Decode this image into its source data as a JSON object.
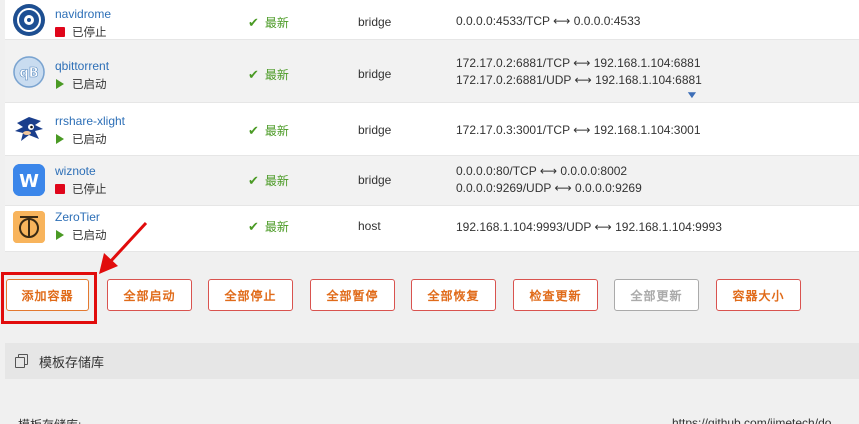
{
  "containers": [
    {
      "name": "navidrome",
      "status": "已停止",
      "state": "stopped",
      "update": "最新",
      "network": "bridge",
      "ports": [
        "0.0.0.0:4533/TCP ⟷ 0.0.0.0:4533"
      ]
    },
    {
      "name": "qbittorrent",
      "status": "已启动",
      "state": "running",
      "update": "最新",
      "network": "bridge",
      "ports": [
        "172.17.0.2:6881/TCP ⟷ 192.168.1.104:6881",
        "172.17.0.2:6881/UDP ⟷ 192.168.1.104:6881"
      ]
    },
    {
      "name": "rrshare-xlight",
      "status": "已启动",
      "state": "running",
      "update": "最新",
      "network": "bridge",
      "ports": [
        "172.17.0.3:3001/TCP ⟷ 192.168.1.104:3001"
      ]
    },
    {
      "name": "wiznote",
      "status": "已停止",
      "state": "stopped",
      "update": "最新",
      "network": "bridge",
      "ports": [
        "0.0.0.0:80/TCP ⟷ 0.0.0.0:8002",
        "0.0.0.0:9269/UDP ⟷ 0.0.0.0:9269"
      ]
    },
    {
      "name": "ZeroTier",
      "status": "已启动",
      "state": "running",
      "update": "最新",
      "network": "host",
      "ports": [
        "192.168.1.104:9993/UDP ⟷ 192.168.1.104:9993"
      ]
    }
  ],
  "icons": {
    "navidrome": "vinyl-record-icon",
    "qbittorrent": "qb-logo-icon",
    "rrshare": "sonic-hedgehog-icon",
    "wiznote": "w-logo-icon",
    "zerotier": "zerotier-logo-icon",
    "status_running": "play-triangle-icon",
    "status_stopped": "stop-square-icon",
    "update": "checkmark-icon",
    "expand": "chevron-down-icon",
    "section": "copy-icon"
  },
  "buttons": {
    "add_container": "添加容器",
    "start_all": "全部启动",
    "stop_all": "全部停止",
    "pause_all": "全部暂停",
    "resume_all": "全部恢复",
    "check_update": "检查更新",
    "update_all": "全部更新",
    "container_size": "容器大小"
  },
  "template_section": {
    "title": "模板存储库",
    "row_label": "模板存储库:",
    "row_value": "https://github.com/jimetech/do"
  },
  "colors": {
    "accent_orange": "#e06b1a",
    "running_green": "#4a9a24",
    "stopped_red": "#e0061b",
    "link_blue": "#2d6fb7",
    "annotation_red": "#e10c0c"
  }
}
